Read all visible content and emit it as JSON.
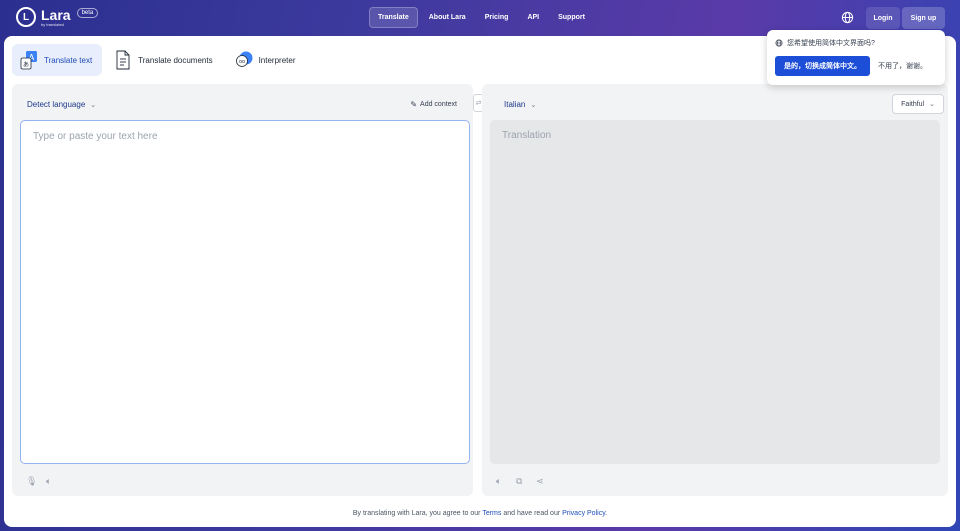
{
  "brand": {
    "mark": "L",
    "name": "Lara",
    "sub": "by translated",
    "badge": "beta"
  },
  "nav": [
    {
      "label": "Translate",
      "active": true
    },
    {
      "label": "About Lara",
      "active": false
    },
    {
      "label": "Pricing",
      "active": false
    },
    {
      "label": "API",
      "active": false
    },
    {
      "label": "Support",
      "active": false
    }
  ],
  "header": {
    "globe_icon": "globe-icon",
    "login_label": "Login",
    "signup_label": "Sign up"
  },
  "tabs": [
    {
      "label": "Translate text",
      "icon": "translate-text-icon"
    },
    {
      "label": "Translate documents",
      "icon": "document-icon"
    },
    {
      "label": "Interpreter",
      "icon": "interpreter-icon"
    }
  ],
  "source": {
    "language": "Detect language",
    "add_context_label": "Add context",
    "placeholder": "Type or paste your text here",
    "value": ""
  },
  "target": {
    "language": "Italian",
    "style": "Faithful",
    "placeholder": "Translation"
  },
  "footer": {
    "prefix": "By translating with Lara, you agree to our",
    "terms": "Terms",
    "middle": "and have read our",
    "privacy": "Privacy Policy",
    "suffix": "."
  },
  "popup": {
    "question": "您希望使用简体中文界面吗?",
    "yes_label": "是的，切换成简体中文。",
    "no_label": "不用了，谢谢。"
  },
  "colors": {
    "accent": "#1d4ed8",
    "active_tab_bg": "#e8eefb",
    "link": "#1e4bb8"
  }
}
